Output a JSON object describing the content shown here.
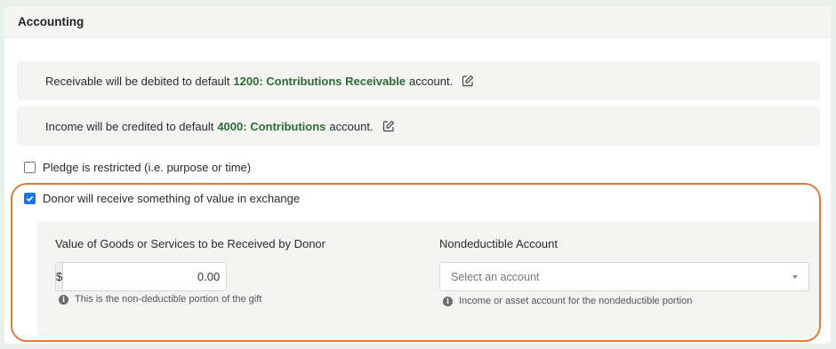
{
  "section": {
    "title": "Accounting"
  },
  "receivable": {
    "prefix": "Receivable will be debited to default",
    "account": "1200: Contributions Receivable",
    "suffix": "account."
  },
  "income": {
    "prefix": "Income will be credited to default",
    "account": "4000: Contributions",
    "suffix": "account."
  },
  "options": {
    "restricted": {
      "label": "Pledge is restricted (i.e. purpose or time)",
      "checked": false
    },
    "exchange": {
      "label": "Donor will receive something of value in exchange",
      "checked": true
    }
  },
  "goods": {
    "label": "Value of Goods or Services to be Received by Donor",
    "currency": "$",
    "value": "0.00",
    "help": "This is the non-deductible portion of the gift"
  },
  "nondeductible": {
    "label": "Nondeductible Account",
    "placeholder": "Select an account",
    "help": "Income or asset account for the nondeductible portion"
  },
  "colors": {
    "accent_green": "#2e6b34",
    "highlight_orange": "#e07b39",
    "checkbox_blue": "#1a73e8"
  }
}
